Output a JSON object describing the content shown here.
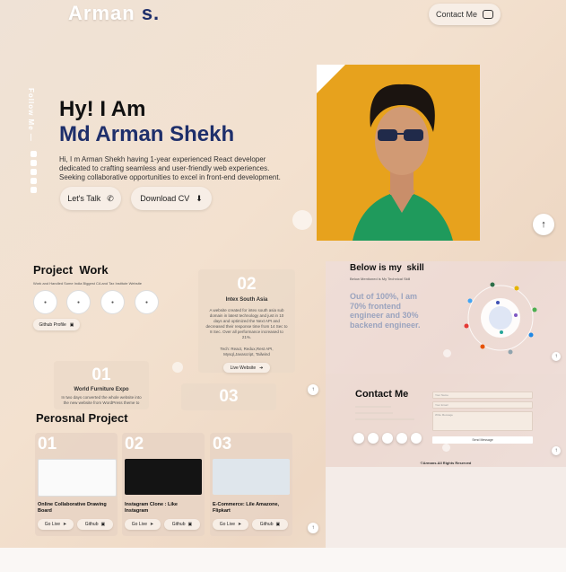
{
  "header": {
    "logo_main": "Arman",
    "logo_suffix": "s.",
    "contact_label": "Contact Me"
  },
  "sidebar": {
    "follow_label": "Follow Me —"
  },
  "hero": {
    "greeting": "Hy!  I Am",
    "name": "Md Arman Shekh",
    "description": "Hi, I m Arman Shekh having 1-year experienced React developer dedicated to crafting seamless and user-friendly web experiences. Seeking collaborative opportunities to excel in front-end development.",
    "lets_talk_label": "Let's Talk",
    "download_cv_label": "Download CV"
  },
  "projects": {
    "title_1": "Project",
    "title_2": "Work",
    "subtitle": "Work and Handled Some India Biggest CA and Tax Institute Website",
    "github_label": "Github Profile",
    "items": [
      {
        "num": "01",
        "title": "World Furniture Expo",
        "desc": "In two days converted the whole website into the new website from WordPress theme to"
      },
      {
        "num": "02",
        "title": "Intex South Asia",
        "desc": "A website created for intex south asia sub domain in latest technology and just in 10 days and optimized the Next API and decreased their response time from 14 Sec to 8 Sec. Over all performance increased to 21%.",
        "tech": "Tech: React, Redux,Rest API, Mysql,Javascript, Tailwind",
        "button": "Live Website"
      },
      {
        "num": "03"
      }
    ]
  },
  "skills": {
    "title_1": "Below is my",
    "title_2": "skill",
    "subtitle": "Below Mentioned is My Technical Skill",
    "summary": "Out of 100%, I am 70% frontend engineer and 30% backend engineer."
  },
  "contact": {
    "title": "Contact Me",
    "name_placeholder": "Your Name",
    "email_placeholder": "Your Email",
    "message_placeholder": "Write Message",
    "send_label": "Send Message",
    "footer": "©Armans.All Rights Reserved"
  },
  "personal": {
    "title": "Perosnal Project",
    "items": [
      {
        "num": "01",
        "title": "Online Collaborative Drawing Board",
        "live": "Go Live",
        "github": "Github"
      },
      {
        "num": "02",
        "title": "Instagram Clone : Like Instagram",
        "live": "Go Live",
        "github": "Github"
      },
      {
        "num": "03",
        "title": "E-Commerce: Lile Amazone, Flipkart",
        "live": "Go Live",
        "github": "Github"
      }
    ]
  },
  "colors": {
    "accent": "#1e2f6b",
    "photo_bg": "#e7a21d"
  }
}
